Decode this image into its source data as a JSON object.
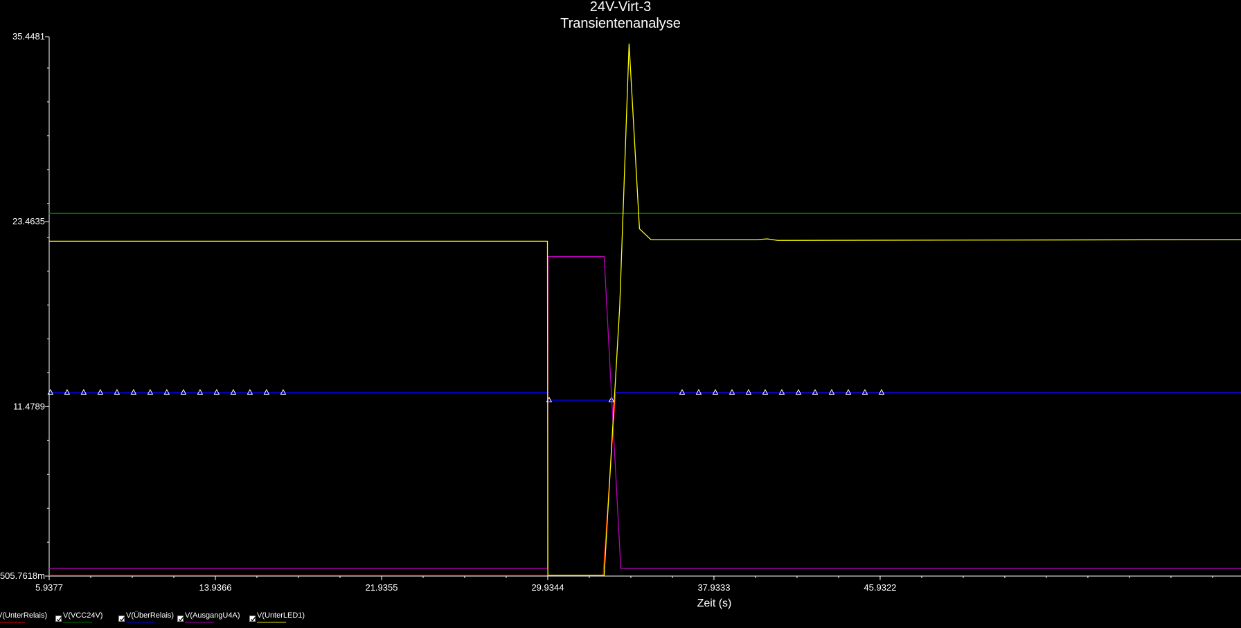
{
  "window": {
    "title": "24V-Virt-3",
    "subtitle": "Transientenanalyse"
  },
  "legend": [
    {
      "label": "V(UnterRelais)",
      "color": "#ff0000",
      "checked": true
    },
    {
      "label": "V(VCC24V)",
      "color": "#008000",
      "checked": true
    },
    {
      "label": "V(ÜberRelais)",
      "color": "#0000ff",
      "checked": true
    },
    {
      "label": "V(AusgangU4A)",
      "color": "#c000c0",
      "checked": true
    },
    {
      "label": "V(UnterLED1)",
      "color": "#ffff00",
      "checked": true
    }
  ],
  "chart_data": {
    "type": "line",
    "title": "24V-Virt-3",
    "subtitle": "Transientenanalyse",
    "xlabel": "Zeit (s)",
    "ylabel": "",
    "xlim": [
      5.9377,
      63.3
    ],
    "ylim": [
      0.5056,
      35.4481
    ],
    "x_ticks": [
      5.9377,
      13.9366,
      21.9355,
      29.9344,
      37.9333,
      45.9322
    ],
    "x_tick_labels": [
      "5.9377",
      "13.9366",
      "21.9355",
      "29.9344",
      "37.9333",
      "45.9322"
    ],
    "y_ticks": [
      0.5056,
      11.4789,
      23.4635,
      35.4481
    ],
    "y_tick_labels": [
      "505.7618m",
      "11.4789",
      "23.4635",
      "35.4481"
    ],
    "grid": false,
    "legend_position": "bottom-left",
    "series": [
      {
        "name": "V(UnterRelais)",
        "color": "#ff0000",
        "x": [
          5.9377,
          29.93,
          29.95,
          32.6,
          32.9,
          33.2,
          63.3
        ],
        "y": [
          0.55,
          0.55,
          0.55,
          0.55,
          6.5,
          12.4,
          12.4
        ]
      },
      {
        "name": "V(VCC24V)",
        "color": "#008000",
        "x": [
          5.9377,
          63.3
        ],
        "y": [
          24.0,
          24.0
        ]
      },
      {
        "name": "V(ÜberRelais)",
        "color": "#0000ff",
        "markers": "triangle",
        "x": [
          5.9377,
          29.93,
          29.95,
          33.0,
          33.2,
          63.3
        ],
        "y": [
          12.4,
          12.4,
          11.9,
          11.9,
          12.4,
          12.4
        ],
        "marker_x": [
          6.0,
          6.8,
          7.6,
          8.4,
          9.2,
          10.0,
          10.8,
          11.6,
          12.4,
          13.2,
          14.0,
          14.8,
          15.6,
          16.4,
          17.2,
          30.0,
          33.0,
          36.4,
          37.2,
          38.0,
          38.8,
          39.6,
          40.4,
          41.2,
          42.0,
          42.8,
          43.6,
          44.4,
          45.2,
          46.0
        ]
      },
      {
        "name": "V(AusgangU4A)",
        "color": "#c000c0",
        "x": [
          5.9377,
          29.93,
          29.95,
          32.65,
          33.45,
          63.3
        ],
        "y": [
          1.0,
          1.0,
          21.2,
          21.2,
          1.0,
          1.0
        ],
        "_note": ""
      },
      {
        "name": "V(UnterLED1)",
        "color": "#ffff00",
        "x": [
          5.9377,
          29.92,
          29.94,
          32.65,
          33.4,
          33.85,
          34.35,
          34.9,
          40.0,
          40.5,
          41.0,
          63.3
        ],
        "y": [
          22.2,
          22.2,
          0.55,
          0.55,
          18.0,
          35.0,
          23.0,
          22.3,
          22.3,
          22.35,
          22.25,
          22.3
        ]
      }
    ]
  }
}
